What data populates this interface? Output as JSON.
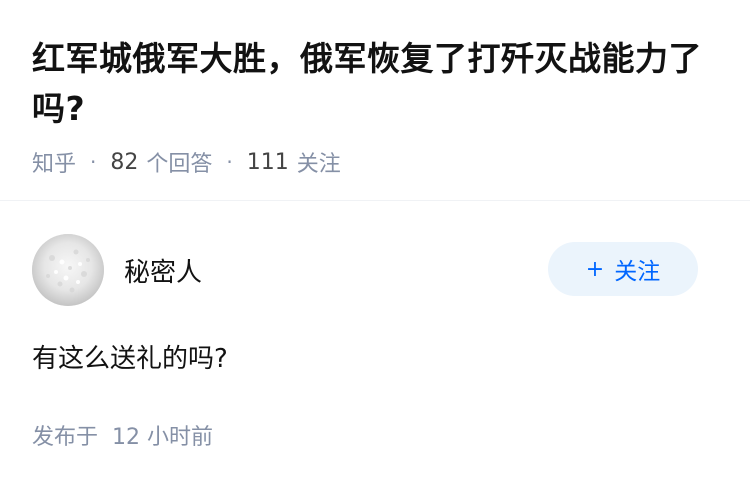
{
  "question": {
    "title": "红军城俄军大胜，俄军恢复了打歼灭战能力了吗?",
    "source": "知乎",
    "answers_count": "82",
    "answers_label": "个回答",
    "followers_count": "111",
    "followers_label": "关注"
  },
  "answer": {
    "author_name": "秘密人",
    "follow_button_plus": "+",
    "follow_button_label": "关注",
    "content": "有这么送礼的吗?",
    "published_label": "发布于",
    "published_time": "12 小时前"
  },
  "colors": {
    "accent": "#0066ff",
    "button_bg": "#ebf4fc",
    "meta_text": "#8590a6"
  },
  "icons": {
    "avatar": "white-textured-avatar"
  }
}
